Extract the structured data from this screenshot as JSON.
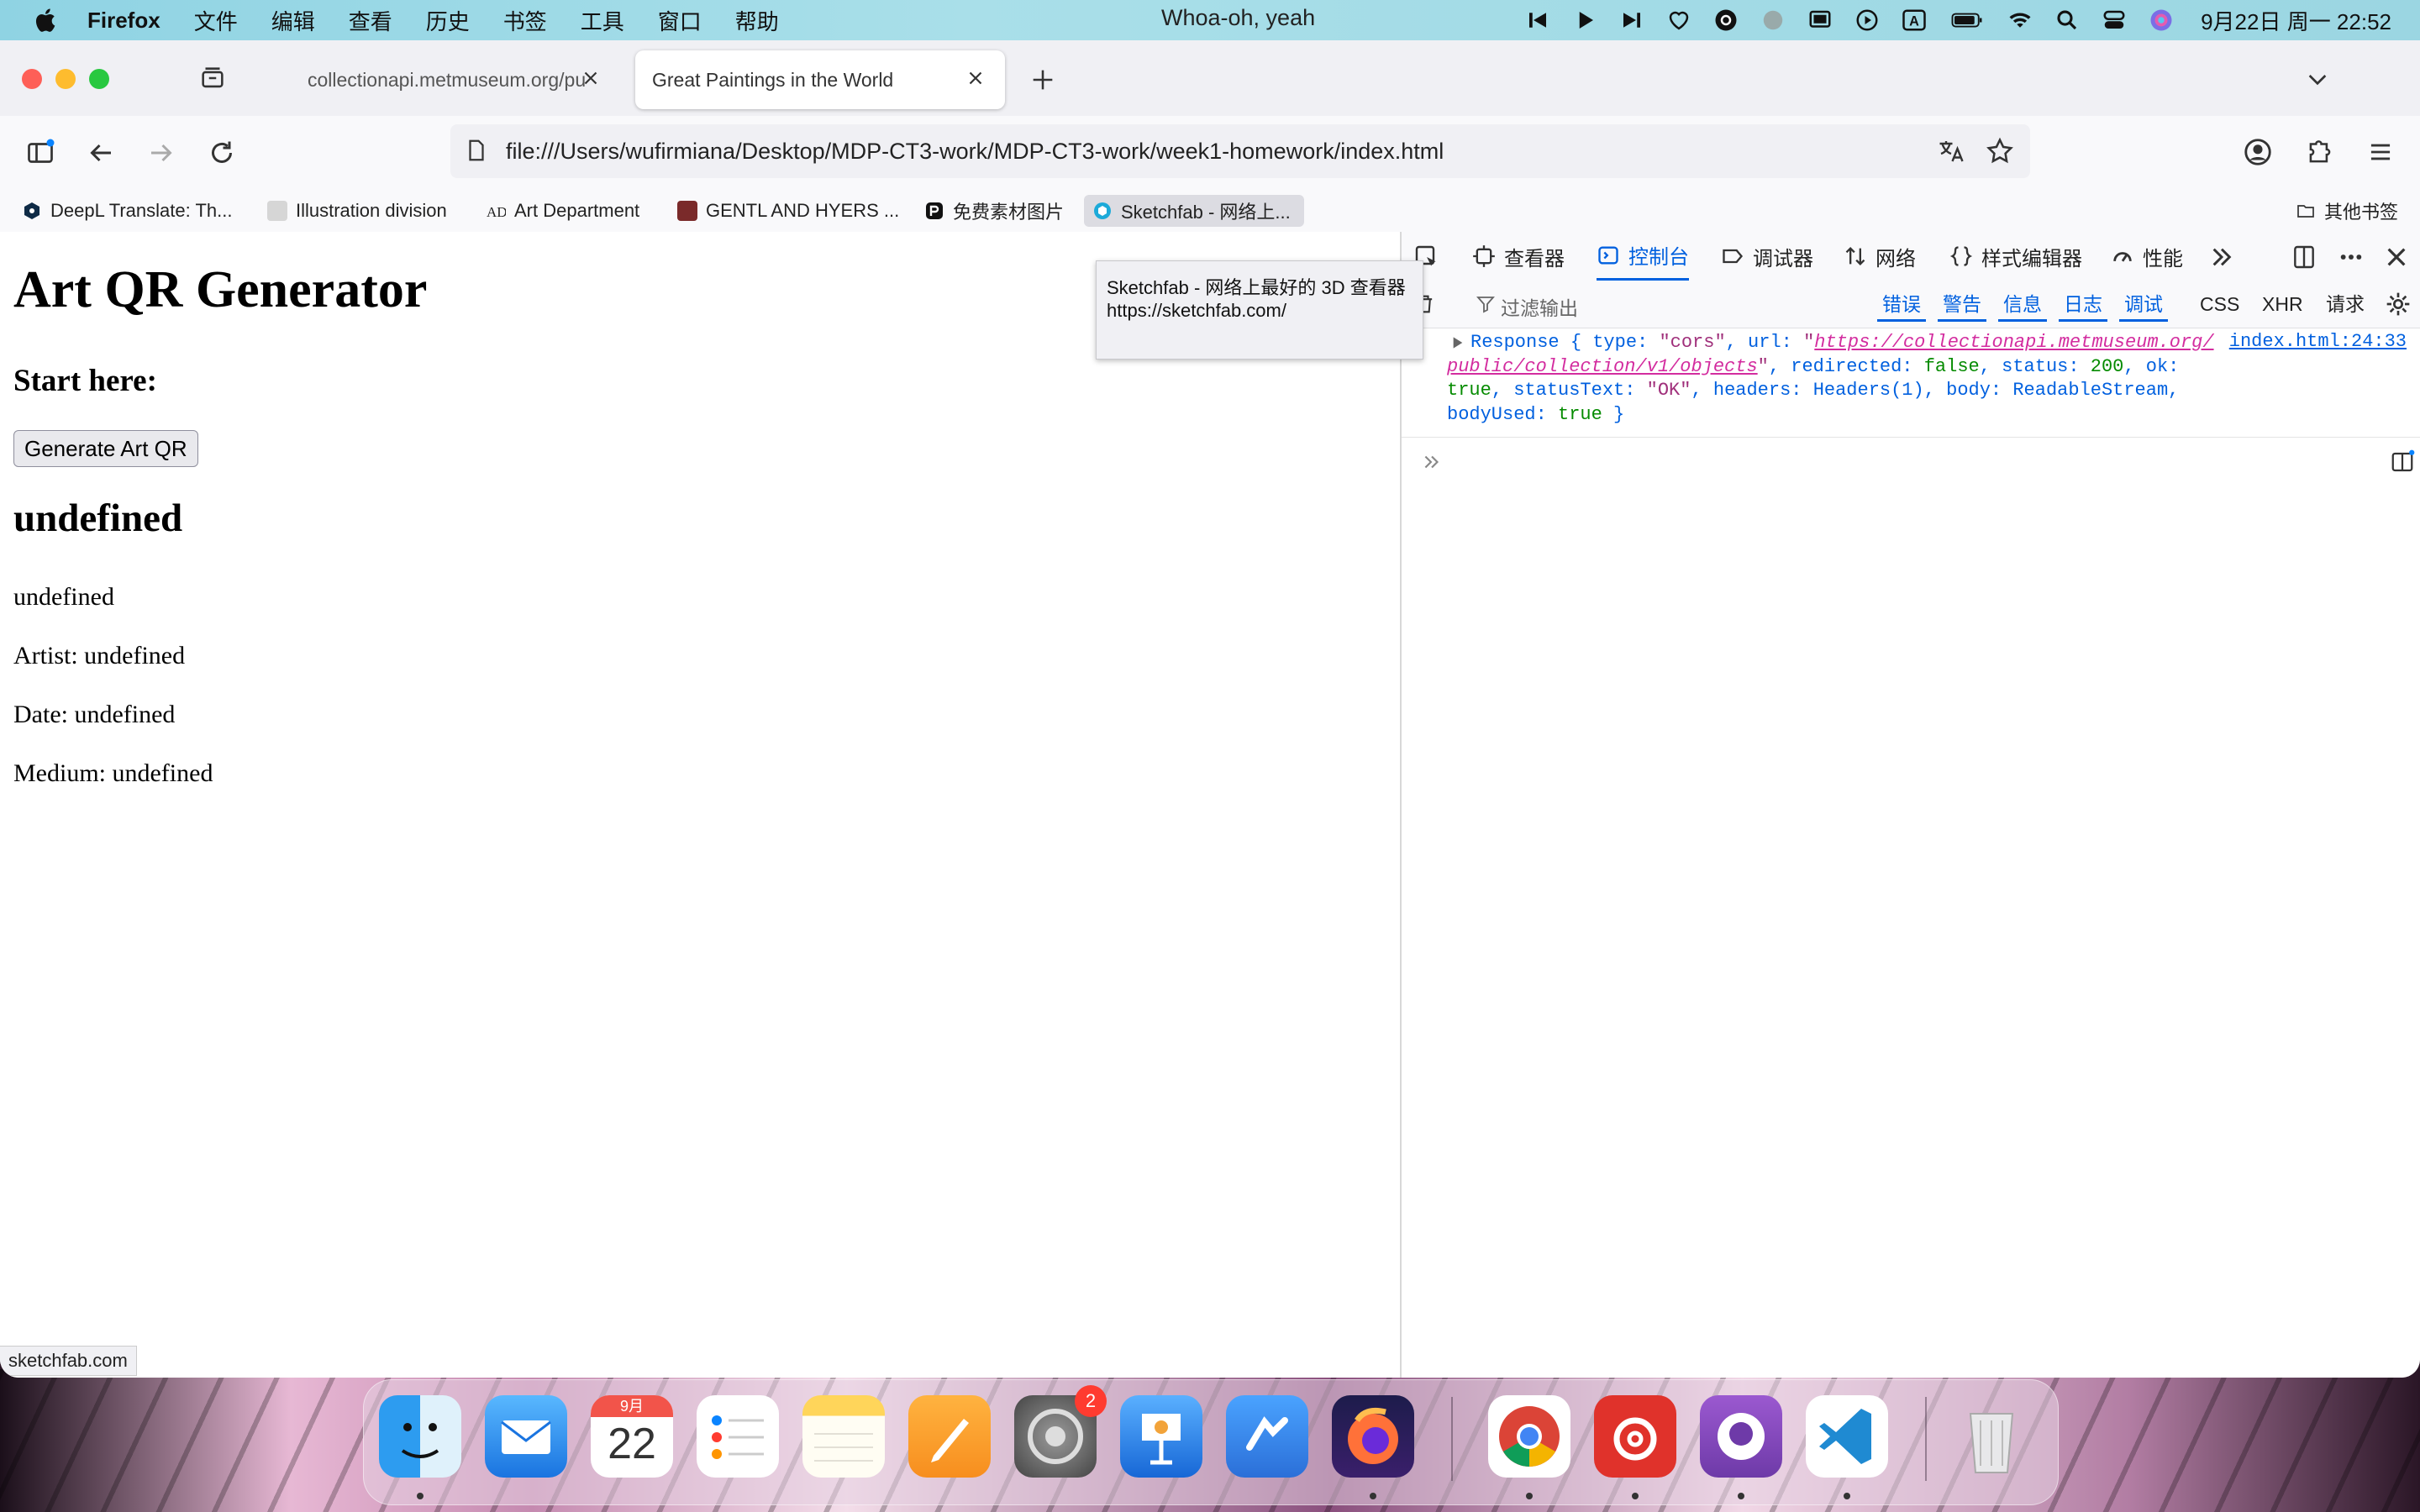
{
  "menubar": {
    "app_name": "Firefox",
    "menus": [
      "文件",
      "编辑",
      "查看",
      "历史",
      "书签",
      "工具",
      "窗口",
      "帮助"
    ],
    "now_playing": "Whoa-oh, yeah",
    "input_source": "A",
    "clock": "9月22日 周一 22:52"
  },
  "tabs": [
    {
      "title": "collectionapi.metmuseum.org/pu",
      "active": false
    },
    {
      "title": "Great Paintings in the World",
      "active": true
    }
  ],
  "navbar": {
    "url": "file:///Users/wufirmiana/Desktop/MDP-CT3-work/MDP-CT3-work/week1-homework/index.html"
  },
  "bookmarks": {
    "items": [
      {
        "label": "DeepL Translate: Th..."
      },
      {
        "label": "Illustration division"
      },
      {
        "label": "Art Department"
      },
      {
        "label": "GENTL AND HYERS ..."
      },
      {
        "label": "免费素材图片"
      },
      {
        "label": "Sketchfab - 网络上..."
      }
    ],
    "other_label": "其他书签"
  },
  "tooltip": {
    "title": "Sketchfab - 网络上最好的 3D 查看器",
    "url": "https://sketchfab.com/"
  },
  "page": {
    "h1": "Art QR Generator",
    "subheading": "Start here:",
    "button_label": "Generate Art QR",
    "artwork_title": "undefined",
    "artwork_desc": "undefined",
    "artist": "Artist: undefined",
    "date": "Date: undefined",
    "medium": "Medium: undefined"
  },
  "status_text": "sketchfab.com",
  "devtools": {
    "tabs": [
      "查看器",
      "控制台",
      "调试器",
      "网络",
      "样式编辑器",
      "性能"
    ],
    "active_tab": "控制台",
    "filter_placeholder": "过滤输出",
    "filters": [
      "错误",
      "警告",
      "信息",
      "日志",
      "调试"
    ],
    "extra_filters": [
      "CSS",
      "XHR",
      "请求"
    ],
    "console": {
      "p1": "Response { type: ",
      "type_val": "\"cors\"",
      "p2": ", url: ",
      "q_open": "\"",
      "url_a": "https://collectionapi.metmuseum.org/",
      "url_b": "public/collection/v1/objects",
      "q_close": "\"",
      "p3": ", redirected: ",
      "redirected_val": "false",
      "p4": ", status: ",
      "status_val": "200",
      "p5": ", ok:",
      "ok_val": "true",
      "p6": ", statusText: ",
      "statusText_val": "\"OK\"",
      "p7": ", headers: Headers(1), body: ReadableStream,",
      "p8": "bodyUsed: ",
      "bodyUsed_val": "true",
      "p9": " }",
      "source": "index.html:24:33"
    }
  },
  "dock": {
    "calendar_month": "9月",
    "calendar_day": "22",
    "settings_badge": "2"
  }
}
